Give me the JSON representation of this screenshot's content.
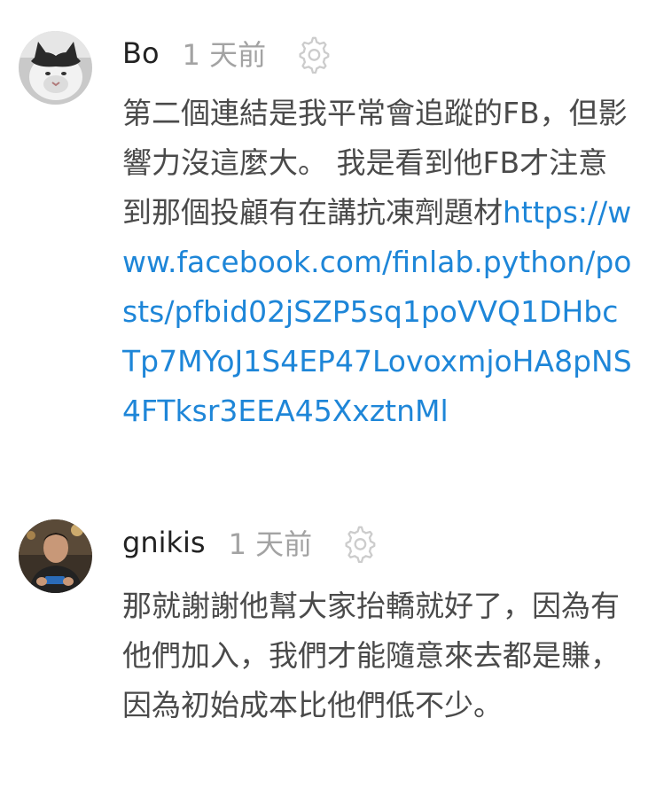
{
  "comments": [
    {
      "author": "Bo",
      "time": "1 天前",
      "text": "第二個連結是我平常會追蹤的FB，但影響力沒這麼大。 我是看到他FB才注意到那個投顧有在講抗凍劑題材",
      "link": "https://www.facebook.com/finlab.python/posts/pfbid02jSZP5sq1poVVQ1DHbcTp7MYoJ1S4EP47LovoxmjoHA8pNS4FTksr3EEA45XxztnMl",
      "avatar_icon": "cat-avatar",
      "settings_icon": "gear-icon"
    },
    {
      "author": "gnikis",
      "time": "1 天前",
      "text": "那就謝謝他幫大家抬轎就好了，因為有他們加入，我們才能隨意來去都是賺，因為初始成本比他們低不少。",
      "avatar_icon": "person-avatar",
      "settings_icon": "gear-icon"
    }
  ],
  "colors": {
    "author": "#222222",
    "timestamp": "#a3a3a3",
    "body_text": "#4a4a4a",
    "link": "#1e86d8",
    "background": "#ffffff"
  }
}
